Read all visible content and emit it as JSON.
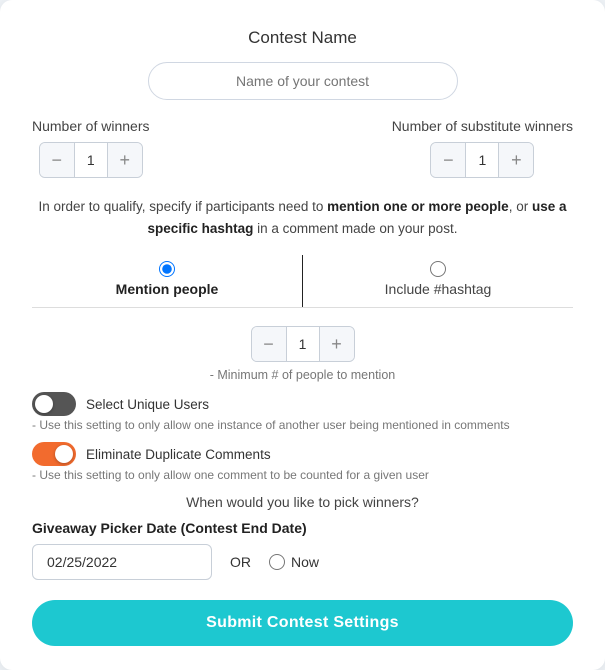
{
  "header": {
    "title": "Contest Name"
  },
  "contest_name_input": {
    "placeholder": "Name of your contest",
    "value": ""
  },
  "winners": {
    "label": "Number of winners",
    "value": "1",
    "minus": "−",
    "plus": "+"
  },
  "substitute_winners": {
    "label": "Number of substitute winners",
    "value": "1",
    "minus": "−",
    "plus": "+"
  },
  "qualify_text": {
    "part1": "In order to qualify, specify if participants need to ",
    "bold1": "mention one or more people",
    "part2": ", or ",
    "bold2": "use a specific hashtag",
    "part3": " in a comment made on your post."
  },
  "tabs": [
    {
      "id": "mention",
      "label": "Mention people",
      "active": true
    },
    {
      "id": "hashtag",
      "label": "Include #hashtag",
      "active": false
    }
  ],
  "mention_stepper": {
    "value": "1",
    "minus": "−",
    "plus": "+",
    "hint": "- Minimum # of people to mention"
  },
  "select_unique": {
    "label": "Select Unique Users",
    "hint": "- Use this setting to only allow one instance of another user being mentioned in comments",
    "enabled": false
  },
  "eliminate_duplicate": {
    "label": "Eliminate Duplicate Comments",
    "hint": "- Use this setting to only allow one comment to be counted for a given user",
    "enabled": true
  },
  "when_text": "When would you like to pick winners?",
  "giveaway_picker": {
    "label": "Giveaway Picker Date (Contest End Date)",
    "date_value": "02/25/2022",
    "or_text": "OR",
    "now_label": "Now"
  },
  "submit_button": {
    "label": "Submit Contest Settings"
  }
}
